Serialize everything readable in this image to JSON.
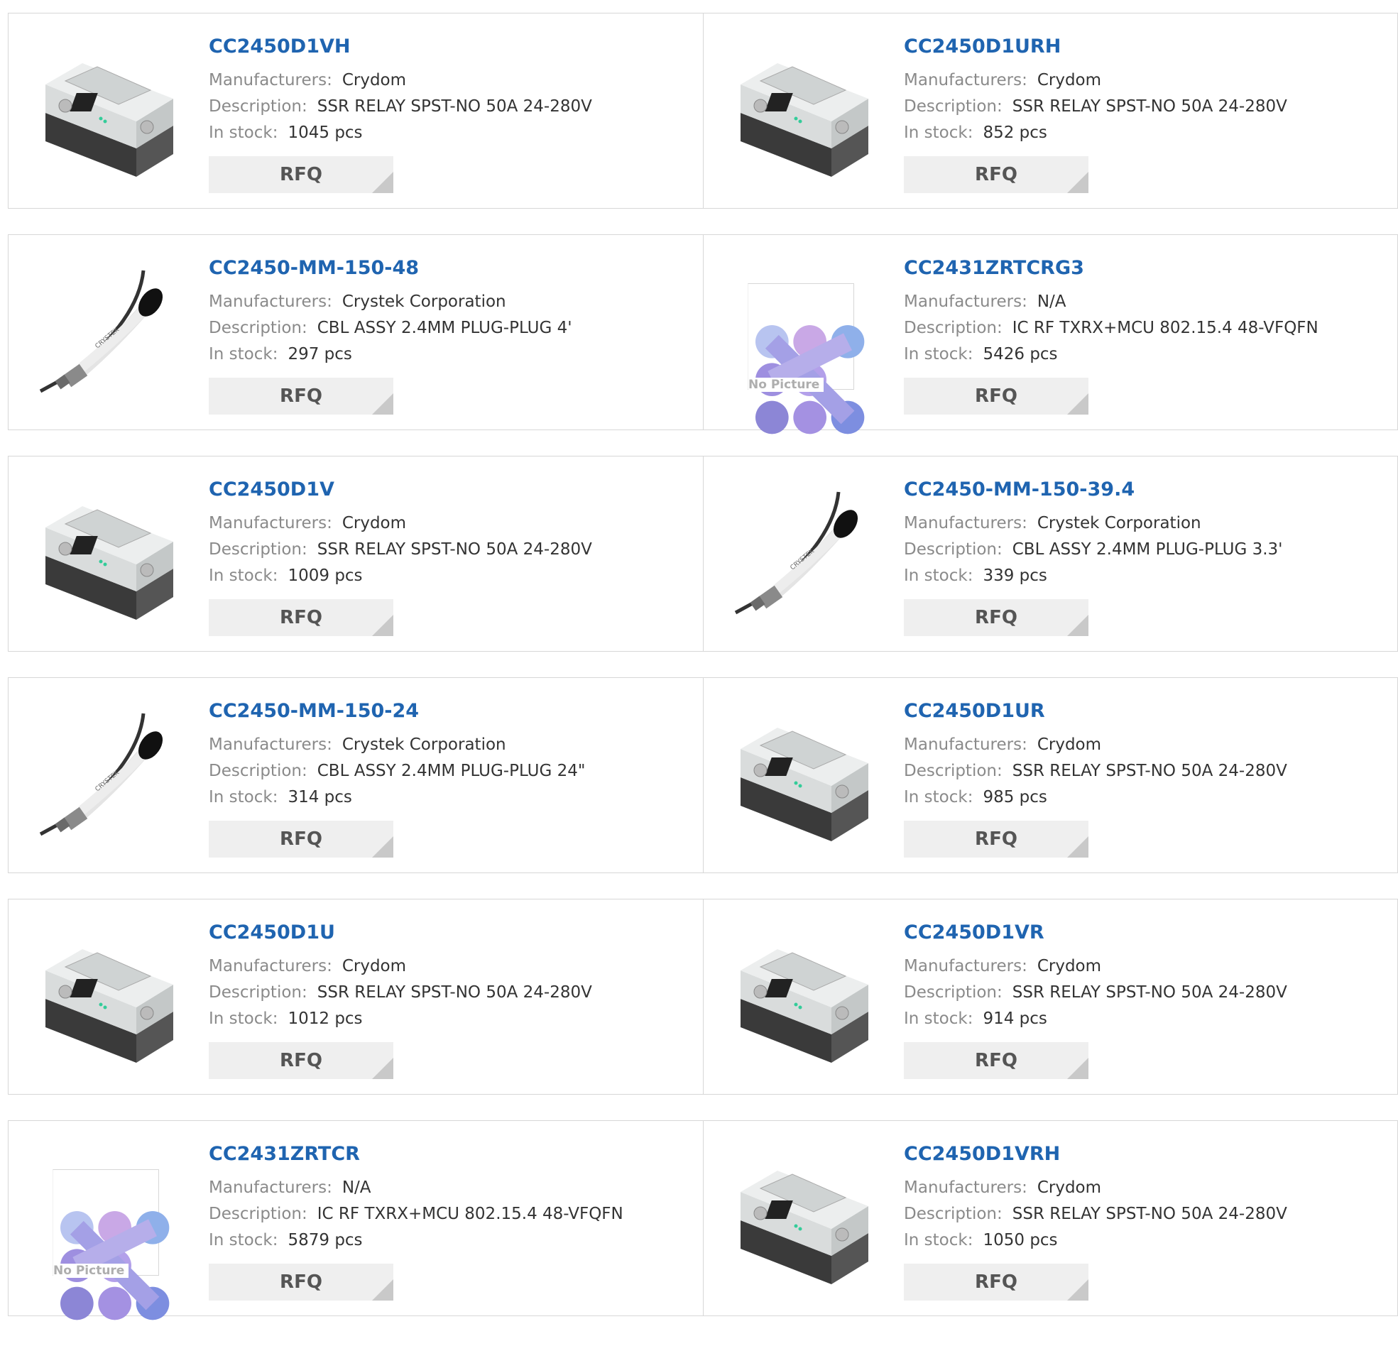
{
  "labels": {
    "manufacturer": "Manufacturers:",
    "description": "Description:",
    "stock": "In stock:",
    "rfq": "RFQ",
    "no_picture": "No Picture"
  },
  "colors": {
    "part_link": "#1f64b0",
    "label_gray": "#8a8a8a",
    "border": "#d7d7d7",
    "rfq_bg": "#efefef"
  },
  "products": [
    {
      "part": "CC2450D1VH",
      "manufacturer": "Crydom",
      "description": "SSR RELAY SPST-NO 50A 24-280V",
      "stock": "1045 pcs",
      "image": "relay-image"
    },
    {
      "part": "CC2450D1URH",
      "manufacturer": "Crydom",
      "description": "SSR RELAY SPST-NO 50A 24-280V",
      "stock": "852 pcs",
      "image": "relay-image"
    },
    {
      "part": "CC2450-MM-150-48",
      "manufacturer": "Crystek Corporation",
      "description": "CBL ASSY 2.4MM PLUG-PLUG 4'",
      "stock": "297 pcs",
      "image": "cable-image"
    },
    {
      "part": "CC2431ZRTCRG3",
      "manufacturer": "N/A",
      "description": "IC RF TXRX+MCU 802.15.4 48-VFQFN",
      "stock": "5426 pcs",
      "image": "no-picture"
    },
    {
      "part": "CC2450D1V",
      "manufacturer": "Crydom",
      "description": "SSR RELAY SPST-NO 50A 24-280V",
      "stock": "1009 pcs",
      "image": "relay-image"
    },
    {
      "part": "CC2450-MM-150-39.4",
      "manufacturer": "Crystek Corporation",
      "description": "CBL ASSY 2.4MM PLUG-PLUG 3.3'",
      "stock": "339 pcs",
      "image": "cable-image"
    },
    {
      "part": "CC2450-MM-150-24",
      "manufacturer": "Crystek Corporation",
      "description": "CBL ASSY 2.4MM PLUG-PLUG 24\"",
      "stock": "314 pcs",
      "image": "cable-image"
    },
    {
      "part": "CC2450D1UR",
      "manufacturer": "Crydom",
      "description": "SSR RELAY SPST-NO 50A 24-280V",
      "stock": "985 pcs",
      "image": "relay-image"
    },
    {
      "part": "CC2450D1U",
      "manufacturer": "Crydom",
      "description": "SSR RELAY SPST-NO 50A 24-280V",
      "stock": "1012 pcs",
      "image": "relay-image"
    },
    {
      "part": "CC2450D1VR",
      "manufacturer": "Crydom",
      "description": "SSR RELAY SPST-NO 50A 24-280V",
      "stock": "914 pcs",
      "image": "relay-image"
    },
    {
      "part": "CC2431ZRTCR",
      "manufacturer": "N/A",
      "description": "IC RF TXRX+MCU 802.15.4 48-VFQFN",
      "stock": "5879 pcs",
      "image": "no-picture"
    },
    {
      "part": "CC2450D1VRH",
      "manufacturer": "Crydom",
      "description": "SSR RELAY SPST-NO 50A 24-280V",
      "stock": "1050 pcs",
      "image": "relay-image"
    }
  ]
}
